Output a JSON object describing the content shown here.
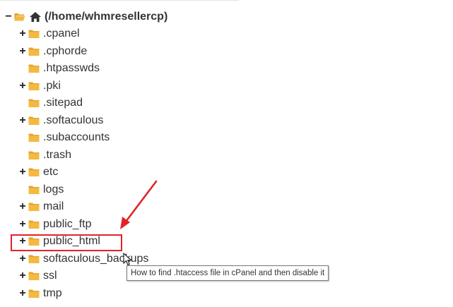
{
  "tree": {
    "root": {
      "toggle": "−",
      "label": "(/home/whmresellercp)",
      "icon": "home-icon"
    },
    "items": [
      {
        "label": ".cpanel",
        "toggle": "+"
      },
      {
        "label": ".cphorde",
        "toggle": "+"
      },
      {
        "label": ".htpasswds",
        "toggle": ""
      },
      {
        "label": ".pki",
        "toggle": "+"
      },
      {
        "label": ".sitepad",
        "toggle": ""
      },
      {
        "label": ".softaculous",
        "toggle": "+"
      },
      {
        "label": ".subaccounts",
        "toggle": ""
      },
      {
        "label": ".trash",
        "toggle": ""
      },
      {
        "label": "etc",
        "toggle": "+"
      },
      {
        "label": "logs",
        "toggle": ""
      },
      {
        "label": "mail",
        "toggle": "+"
      },
      {
        "label": "public_ftp",
        "toggle": "+"
      },
      {
        "label": "public_html",
        "toggle": "+"
      },
      {
        "label": "softaculous_backups",
        "toggle": "+"
      },
      {
        "label": "ssl",
        "toggle": "+"
      },
      {
        "label": "tmp",
        "toggle": "+"
      }
    ]
  },
  "tooltip": {
    "text": "How to find .htaccess file in cPanel and then disable it"
  },
  "colors": {
    "folder": "#f4b942",
    "folder_dark": "#e2a32a",
    "highlight": "#e0232a",
    "text": "#333333"
  }
}
